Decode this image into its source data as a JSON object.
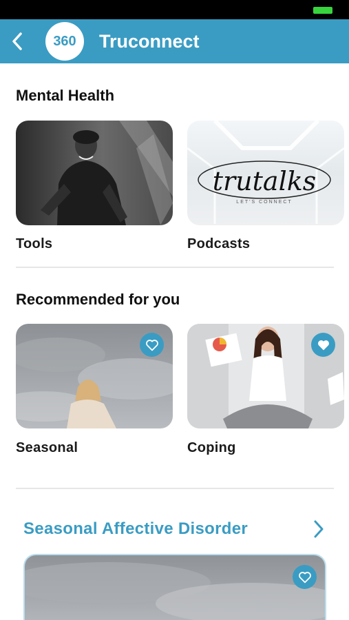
{
  "header": {
    "logo_text": "360",
    "title": "Truconnect"
  },
  "mental_health": {
    "title": "Mental Health",
    "cards": [
      {
        "label": "Tools",
        "image": "smiling-person-bw-photo"
      },
      {
        "label": "Podcasts",
        "image": "trutalks-logo",
        "logo_text": "trutalks",
        "logo_subtext": "LET'S CONNECT"
      }
    ]
  },
  "recommended": {
    "title": "Recommended for you",
    "cards": [
      {
        "label": "Seasonal",
        "image": "woman-cloudy-sky-photo",
        "icon": "heart-outline-icon"
      },
      {
        "label": "Coping",
        "image": "meditating-woman-office-photo",
        "icon": "heart-filled-icon"
      }
    ]
  },
  "featured": {
    "title": "Seasonal Affective Disorder",
    "card_image": "cloudy-sky-photo",
    "icon": "heart-outline-icon"
  },
  "colors": {
    "primary": "#3a9cc3",
    "status_bar": "#000000",
    "battery": "#38d43e"
  }
}
